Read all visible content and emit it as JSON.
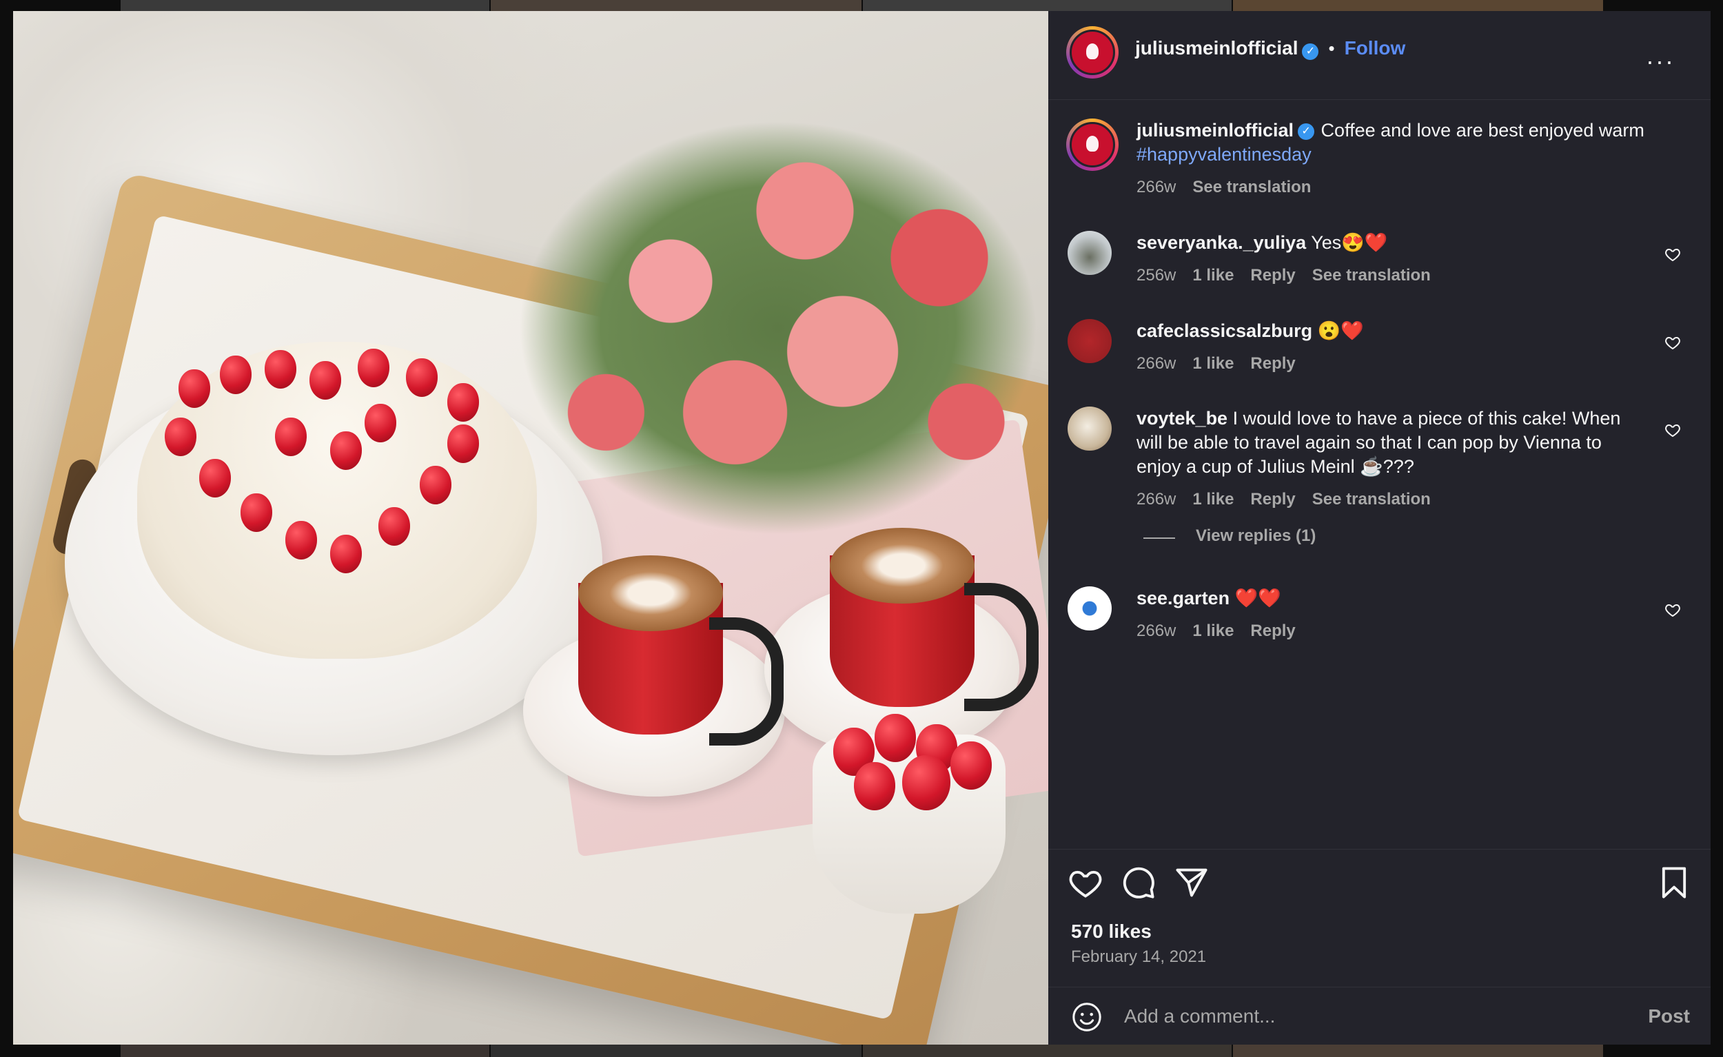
{
  "post": {
    "username": "juliusmeinlofficial",
    "follow_label": "Follow",
    "separator": "•",
    "more_label": "···"
  },
  "caption": {
    "username": "juliusmeinlofficial",
    "text": " Coffee and love are best enjoyed warm",
    "hashtag": "#happyvalentinesday",
    "time": "266w",
    "see_translation": "See translation"
  },
  "comments": [
    {
      "username": "severyanka._yuliya",
      "text": " Yes😍❤️",
      "time": "256w",
      "likes": "1 like",
      "reply": "Reply",
      "translation": "See translation"
    },
    {
      "username": "cafeclassicsalzburg",
      "text": " 😮❤️",
      "time": "266w",
      "likes": "1 like",
      "reply": "Reply",
      "translation": ""
    },
    {
      "username": "voytek_be",
      "text": " I would love to have a piece of this cake! When will be able to travel again so that I can pop by Vienna to enjoy a cup of Julius Meinl ☕???",
      "time": "266w",
      "likes": "1 like",
      "reply": "Reply",
      "translation": "See translation"
    },
    {
      "username": "see.garten",
      "text": " ❤️❤️",
      "time": "266w",
      "likes": "1 like",
      "reply": "Reply",
      "translation": ""
    }
  ],
  "view_replies": "View replies (1)",
  "stats": {
    "likes": "570 likes",
    "date": "February 14, 2021"
  },
  "composer": {
    "placeholder": "Add a comment...",
    "post_label": "Post"
  },
  "icons": {
    "like": "heart-icon",
    "comment": "comment-icon",
    "share": "send-icon",
    "save": "bookmark-icon",
    "emoji": "emoji-icon",
    "more": "more-icon"
  },
  "colors": {
    "panel_bg": "#23232b",
    "link_blue": "#5b8cf5",
    "hashtag": "#7ea8f8",
    "muted": "#a8a8a8",
    "verified": "#3897f0"
  }
}
